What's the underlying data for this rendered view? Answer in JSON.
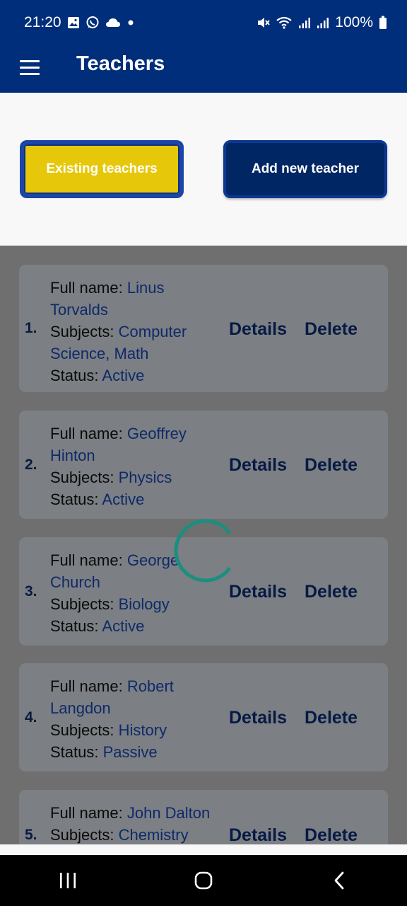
{
  "status_bar": {
    "time": "21:20",
    "battery": "100%",
    "icons_left": [
      "gallery-icon",
      "whatsapp-icon",
      "cloud-icon",
      "dot-icon"
    ],
    "icons_right": [
      "mute-icon",
      "wifi-icon",
      "signal-icon",
      "signal-icon",
      "battery-icon"
    ]
  },
  "app_bar": {
    "title": "Teachers",
    "menu_icon": "hamburger-menu-icon"
  },
  "tabs": {
    "existing_label": "Existing teachers",
    "add_label": "Add new teacher"
  },
  "labels": {
    "full_name": "Full name:",
    "subjects": "Subjects:",
    "status": "Status:",
    "details": "Details",
    "delete": "Delete"
  },
  "teachers": [
    {
      "num": "1.",
      "name_line1": "Linus",
      "name_line2": "Torvalds",
      "subjects_line1": "Computer",
      "subjects_line2": "Science, Math",
      "status": "Active"
    },
    {
      "num": "2.",
      "name_line1": "Geoffrey",
      "name_line2": "Hinton",
      "subjects_line1": "Physics",
      "subjects_line2": "",
      "status": "Active"
    },
    {
      "num": "3.",
      "name_line1": "George",
      "name_line2": "Church",
      "subjects_line1": "Biology",
      "subjects_line2": "",
      "status": "Active"
    },
    {
      "num": "4.",
      "name_line1": "Robert",
      "name_line2": "Langdon",
      "subjects_line1": "History",
      "subjects_line2": "",
      "status": "Passive"
    },
    {
      "num": "5.",
      "name_line1": "John Dalton",
      "name_line2": "",
      "subjects_line1": "Chemistry",
      "subjects_line2": "",
      "status": ""
    }
  ],
  "colors": {
    "primary": "#002e7a",
    "accent": "#e6c709",
    "overlay": "#6f6f6f",
    "spinner": "#1a8f7f"
  },
  "nav": {
    "recent_icon": "recent-apps-icon",
    "home_icon": "home-icon",
    "back_icon": "back-icon"
  }
}
